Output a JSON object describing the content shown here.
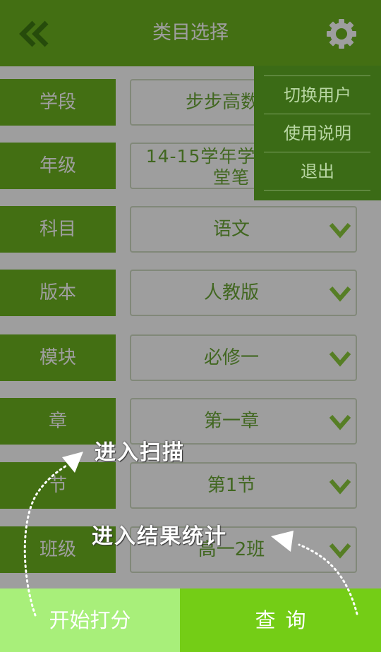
{
  "header": {
    "title": "类目选择",
    "back_icon": "double-chevron-left-icon",
    "settings_icon": "gear-icon"
  },
  "form": {
    "rows": [
      {
        "label": "学段",
        "value": "步步高数字"
      },
      {
        "label": "年级",
        "value": "14-15学年学科网 随堂笔"
      },
      {
        "label": "科目",
        "value": "语文"
      },
      {
        "label": "版本",
        "value": "人教版"
      },
      {
        "label": "模块",
        "value": "必修一"
      },
      {
        "label": "章",
        "value": "第一章"
      },
      {
        "label": "节",
        "value": "第1节"
      },
      {
        "label": "班级",
        "value": "高一2班"
      }
    ]
  },
  "menu": {
    "items": [
      "切换用户",
      "使用说明",
      "退出"
    ]
  },
  "bottom": {
    "start_label": "开始打分",
    "query_label": "查询"
  },
  "hints": {
    "scan": "进入扫描",
    "stats": "进入结果统计"
  },
  "colors": {
    "brand_green": "#6db31f",
    "start_button": "#a8ef7a",
    "query_button": "#74cd16",
    "menu_bg": "#3b6b16",
    "value_text": "#6aa634"
  }
}
